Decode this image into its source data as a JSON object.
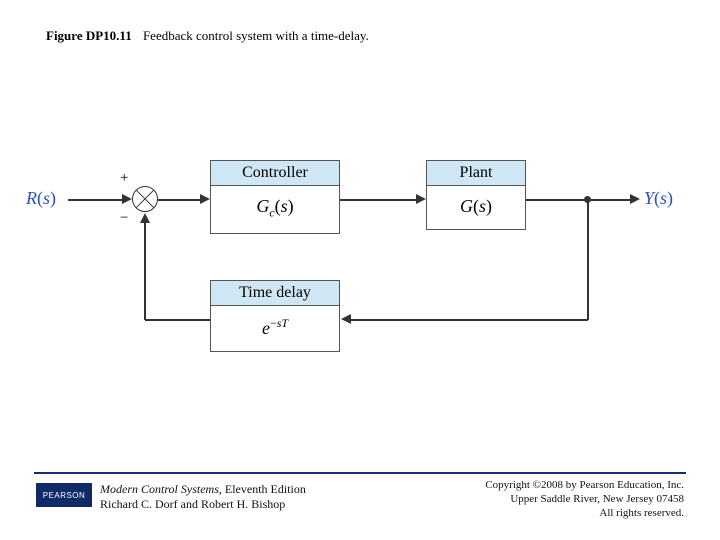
{
  "figure": {
    "number": "Figure DP10.11",
    "caption": "Feedback control system with a time-delay."
  },
  "diagram": {
    "input_label": "R(s)",
    "output_label": "Y(s)",
    "sum_plus": "+",
    "sum_minus": "−",
    "blocks": {
      "controller": {
        "title": "Controller",
        "tf": "G_c(s)"
      },
      "plant": {
        "title": "Plant",
        "tf": "G(s)"
      },
      "delay": {
        "title": "Time delay",
        "tf": "e^{-sT}"
      }
    }
  },
  "publisher": {
    "logo": "PEARSON",
    "book_title": "Modern Control Systems",
    "edition": ", Eleventh Edition",
    "authors": "Richard C. Dorf and Robert H. Bishop",
    "copyright_line1": "Copyright ©2008 by Pearson Education, Inc.",
    "copyright_line2": "Upper Saddle River, New Jersey 07458",
    "copyright_line3": "All rights reserved."
  }
}
